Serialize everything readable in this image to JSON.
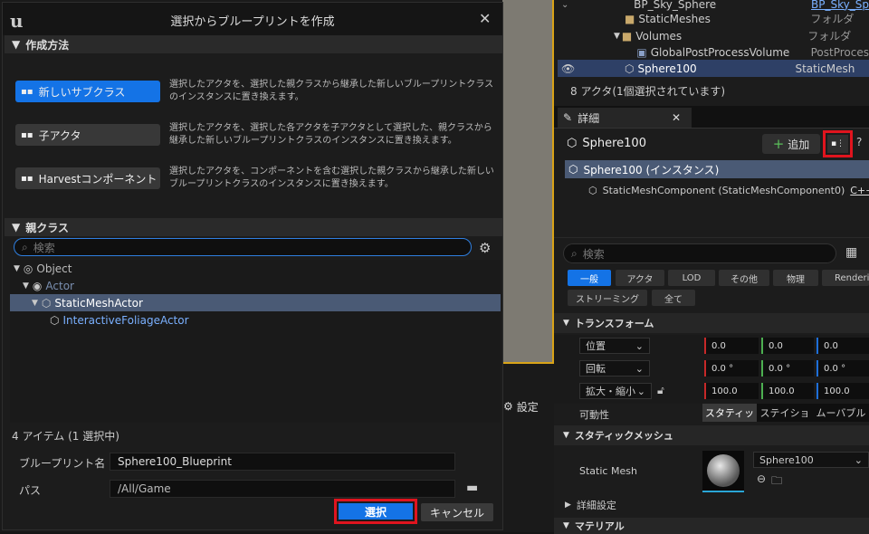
{
  "dialog": {
    "title": "選択からブループリントを作成",
    "method_header": "作成方法",
    "options": [
      {
        "label": "新しいサブクラス",
        "desc": "選択したアクタを、選択した親クラスから継承した新しいブループリントクラスのインスタンスに置き換えます。"
      },
      {
        "label": "子アクタ",
        "desc": "選択したアクタを、選択した各アクタを子アクタとして選択した、親クラスから継承した新しいブループリントクラスのインスタンスに置き換えます。"
      },
      {
        "label": "Harvestコンポーネント",
        "desc": "選択したアクタを、コンポーネントを含む選択した親クラスから継承した新しいブループリントクラスのインスタンスに置き換えます。"
      }
    ],
    "parent_header": "親クラス",
    "search_placeholder": "検索",
    "tree": [
      "Object",
      "Actor",
      "StaticMeshActor",
      "InteractiveFoliageActor"
    ],
    "item_count": "4 アイテム (1 選択中)",
    "bp_name_label": "ブループリント名",
    "bp_name_value": "Sphere100_Blueprint",
    "path_label": "パス",
    "path_value": "/All/Game",
    "select_button": "選択",
    "cancel_button": "キャンセル"
  },
  "settings_label": "設定",
  "outliner": {
    "rows": [
      {
        "name": "BP_Sky_Sphere",
        "type": "BP_Sky_Sp"
      },
      {
        "name": "StaticMeshes",
        "type": "フォルダ"
      },
      {
        "name": "Volumes",
        "type": "フォルダ"
      },
      {
        "name": "GlobalPostProcessVolume",
        "type": "PostProces"
      },
      {
        "name": "Sphere100",
        "type": "StaticMesh"
      }
    ],
    "status": "8 アクタ(1個選択されています)"
  },
  "details": {
    "tab_label": "詳細",
    "actor_name": "Sphere100",
    "add_button": "追加",
    "instance_row": "Sphere100 (インスタンス)",
    "component_row": "StaticMeshComponent (StaticMeshComponent0)",
    "component_suffix": "C++",
    "search_placeholder": "検索",
    "categories_row1": [
      "一般",
      "アクタ",
      "LOD",
      "その他",
      "物理",
      "Rendering"
    ],
    "categories_row2": [
      "ストリーミング",
      "全て"
    ],
    "transform_header": "トランスフォーム",
    "location_label": "位置",
    "rotation_label": "回転",
    "scale_label": "拡大・縮小",
    "location": [
      "0.0",
      "0.0",
      "0.0"
    ],
    "rotation": [
      "0.0 °",
      "0.0 °",
      "0.0 °"
    ],
    "scale": [
      "100.0",
      "100.0",
      "100.0"
    ],
    "mobility_label": "可動性",
    "mobility_options": [
      "スタティッ",
      "ステイショ",
      "ムーバブル"
    ],
    "static_mesh_header": "スタティックメッシュ",
    "static_mesh_label": "Static Mesh",
    "static_mesh_value": "Sphere100",
    "advanced_label": "詳細設定",
    "material_header": "マテリアル"
  }
}
